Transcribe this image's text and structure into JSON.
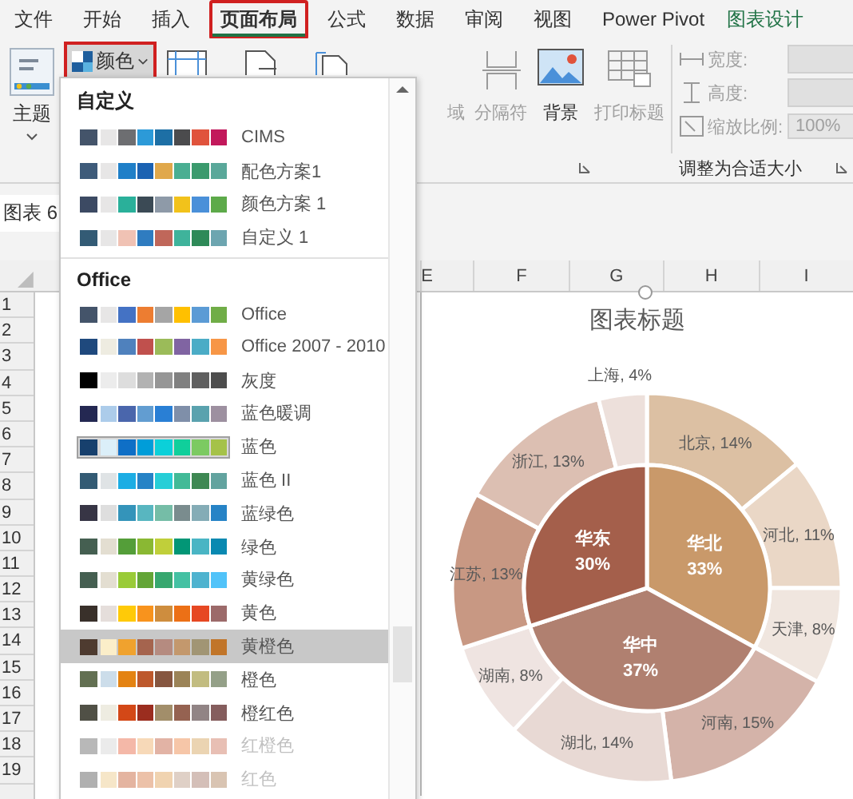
{
  "tabs": [
    {
      "label": "文件",
      "selected": false,
      "highlighted": false,
      "contextual": false
    },
    {
      "label": "开始",
      "selected": false,
      "highlighted": false,
      "contextual": false
    },
    {
      "label": "插入",
      "selected": false,
      "highlighted": false,
      "contextual": false
    },
    {
      "label": "页面布局",
      "selected": true,
      "highlighted": true,
      "contextual": false
    },
    {
      "label": "公式",
      "selected": false,
      "highlighted": false,
      "contextual": false
    },
    {
      "label": "数据",
      "selected": false,
      "highlighted": false,
      "contextual": false
    },
    {
      "label": "审阅",
      "selected": false,
      "highlighted": false,
      "contextual": false
    },
    {
      "label": "视图",
      "selected": false,
      "highlighted": false,
      "contextual": false
    },
    {
      "label": "Power Pivot",
      "selected": false,
      "highlighted": false,
      "contextual": false
    },
    {
      "label": "图表设计",
      "selected": false,
      "highlighted": false,
      "contextual": true
    }
  ],
  "ribbon": {
    "theme_button": {
      "label": "主题"
    },
    "colors_button": {
      "label": "颜色",
      "highlighted": true
    },
    "page_buttons": [
      {
        "label": "域",
        "disabled": true,
        "kind": "area"
      },
      {
        "label": "分隔符",
        "disabled": true,
        "kind": "breaks"
      },
      {
        "label": "背景",
        "disabled": false,
        "kind": "background"
      },
      {
        "label": "打印标题",
        "disabled": true,
        "kind": "titles"
      }
    ],
    "scale_group": {
      "width_label": "宽度:",
      "height_label": "高度:",
      "scale_label": "缩放比例:",
      "scale_value": "100%",
      "group_label": "调整为合适大小"
    }
  },
  "name_box": "图表 6",
  "columns": [
    "E",
    "F",
    "G",
    "H",
    "I"
  ],
  "rows": [
    "1",
    "2",
    "3",
    "4",
    "5",
    "6",
    "7",
    "8",
    "9",
    "10",
    "11",
    "12",
    "13",
    "14",
    "15",
    "16",
    "17",
    "18",
    "19"
  ],
  "menu": {
    "sections": [
      {
        "title": "自定义",
        "items": [
          {
            "label": "CIMS",
            "selected": false,
            "current": false,
            "disabled": false,
            "swatches": [
              {
                "color": "#44546a"
              },
              {
                "color": "#e7e6e6"
              },
              {
                "color": "#6d6e71"
              },
              {
                "color": "#2c9ad8"
              },
              {
                "color": "#1d6fa5"
              },
              {
                "color": "#4b4b4d"
              },
              {
                "color": "#e0533c"
              },
              {
                "color": "#c2185b"
              }
            ]
          },
          {
            "label": "配色方案1",
            "selected": false,
            "current": false,
            "disabled": false,
            "swatches": [
              {
                "color": "#3e5b7a"
              },
              {
                "color": "#e7e6e6"
              },
              {
                "color": "#1f7fc8"
              },
              {
                "color": "#1b62b2"
              },
              {
                "color": "#e0a84b"
              },
              {
                "color": "#4aae92"
              },
              {
                "color": "#3b9a6d"
              },
              {
                "color": "#5aa89a"
              }
            ]
          },
          {
            "label": "颜色方案 1",
            "selected": false,
            "current": false,
            "disabled": false,
            "swatches": [
              {
                "color": "#3c4a63"
              },
              {
                "color": "#e7e6e6"
              },
              {
                "color": "#2ab09a"
              },
              {
                "color": "#3b4a55"
              },
              {
                "color": "#8e9aa8"
              },
              {
                "color": "#f2c21b"
              },
              {
                "color": "#4a90d9"
              },
              {
                "color": "#5daa4a"
              }
            ]
          },
          {
            "label": "自定义 1",
            "selected": false,
            "current": false,
            "disabled": false,
            "swatches": [
              {
                "color": "#335b75"
              },
              {
                "color": "#e7e6e6"
              },
              {
                "color": "#f0c2b4"
              },
              {
                "color": "#2f7cc0"
              },
              {
                "color": "#c0675a"
              },
              {
                "color": "#3fb39b"
              },
              {
                "color": "#2e8a58"
              },
              {
                "color": "#6da5b0"
              }
            ]
          }
        ]
      },
      {
        "title": "Office",
        "items": [
          {
            "label": "Office",
            "selected": false,
            "current": false,
            "disabled": false,
            "swatches": [
              {
                "color": "#44546a"
              },
              {
                "color": "#e7e6e6"
              },
              {
                "color": "#4472c4"
              },
              {
                "color": "#ed7d31"
              },
              {
                "color": "#a5a5a5"
              },
              {
                "color": "#ffc000"
              },
              {
                "color": "#5b9bd5"
              },
              {
                "color": "#70ad47"
              }
            ]
          },
          {
            "label": "Office 2007 - 2010",
            "selected": false,
            "current": false,
            "disabled": false,
            "swatches": [
              {
                "color": "#1f497d"
              },
              {
                "color": "#eeece1"
              },
              {
                "color": "#4f81bd"
              },
              {
                "color": "#c0504d"
              },
              {
                "color": "#9bbb59"
              },
              {
                "color": "#8064a2"
              },
              {
                "color": "#4bacc6"
              },
              {
                "color": "#f79646"
              }
            ]
          },
          {
            "label": "灰度",
            "selected": false,
            "current": false,
            "disabled": false,
            "swatches": [
              {
                "color": "#000000"
              },
              {
                "color": "#ececec"
              },
              {
                "color": "#dddddd"
              },
              {
                "color": "#b2b2b2"
              },
              {
                "color": "#969696"
              },
              {
                "color": "#808080"
              },
              {
                "color": "#5f5f5f"
              },
              {
                "color": "#4d4d4d"
              }
            ]
          },
          {
            "label": "蓝色暖调",
            "selected": false,
            "current": false,
            "disabled": false,
            "swatches": [
              {
                "color": "#242852"
              },
              {
                "color": "#acccea"
              },
              {
                "color": "#4a66ac"
              },
              {
                "color": "#629dd1"
              },
              {
                "color": "#297fd5"
              },
              {
                "color": "#7f8fa9"
              },
              {
                "color": "#5aa2ae"
              },
              {
                "color": "#9d90a0"
              }
            ]
          },
          {
            "label": "蓝色",
            "selected": false,
            "current": true,
            "disabled": false,
            "swatches": [
              {
                "color": "#17406d"
              },
              {
                "color": "#dbeff9"
              },
              {
                "color": "#0f6fc6"
              },
              {
                "color": "#009dd9"
              },
              {
                "color": "#0bd0d9"
              },
              {
                "color": "#10cf9b"
              },
              {
                "color": "#7cca62"
              },
              {
                "color": "#a5c249"
              }
            ]
          },
          {
            "label": "蓝色 II",
            "selected": false,
            "current": false,
            "disabled": false,
            "swatches": [
              {
                "color": "#335b74"
              },
              {
                "color": "#dfe3e5"
              },
              {
                "color": "#1cade4"
              },
              {
                "color": "#2683c6"
              },
              {
                "color": "#27ced7"
              },
              {
                "color": "#42ba97"
              },
              {
                "color": "#3e8853"
              },
              {
                "color": "#62a39f"
              }
            ]
          },
          {
            "label": "蓝绿色",
            "selected": false,
            "current": false,
            "disabled": false,
            "swatches": [
              {
                "color": "#373545"
              },
              {
                "color": "#dedede"
              },
              {
                "color": "#3494ba"
              },
              {
                "color": "#58b6c0"
              },
              {
                "color": "#75bda7"
              },
              {
                "color": "#7a8c8e"
              },
              {
                "color": "#84acb6"
              },
              {
                "color": "#2683c6"
              }
            ]
          },
          {
            "label": "绿色",
            "selected": false,
            "current": false,
            "disabled": false,
            "swatches": [
              {
                "color": "#455f51"
              },
              {
                "color": "#e3ded1"
              },
              {
                "color": "#549e39"
              },
              {
                "color": "#8ab833"
              },
              {
                "color": "#c0cf3a"
              },
              {
                "color": "#029676"
              },
              {
                "color": "#4ab5c4"
              },
              {
                "color": "#0989b1"
              }
            ]
          },
          {
            "label": "黄绿色",
            "selected": false,
            "current": false,
            "disabled": false,
            "swatches": [
              {
                "color": "#455f51"
              },
              {
                "color": "#e3ded1"
              },
              {
                "color": "#99cb38"
              },
              {
                "color": "#63a537"
              },
              {
                "color": "#37a76f"
              },
              {
                "color": "#44c1a3"
              },
              {
                "color": "#4eb3cf"
              },
              {
                "color": "#51c3f9"
              }
            ]
          },
          {
            "label": "黄色",
            "selected": false,
            "current": false,
            "disabled": false,
            "swatches": [
              {
                "color": "#39302a"
              },
              {
                "color": "#e5dedb"
              },
              {
                "color": "#ffca08"
              },
              {
                "color": "#f8931d"
              },
              {
                "color": "#ce8d3e"
              },
              {
                "color": "#ec7016"
              },
              {
                "color": "#e64823"
              },
              {
                "color": "#9c6a6a"
              }
            ]
          },
          {
            "label": "黄橙色",
            "selected": true,
            "current": false,
            "disabled": false,
            "swatches": [
              {
                "color": "#4e3b30"
              },
              {
                "color": "#fbeec9"
              },
              {
                "color": "#f0a22e"
              },
              {
                "color": "#a5644e"
              },
              {
                "color": "#b58b80"
              },
              {
                "color": "#c3986d"
              },
              {
                "color": "#a19574"
              },
              {
                "color": "#c17529"
              }
            ]
          },
          {
            "label": "橙色",
            "selected": false,
            "current": false,
            "disabled": false,
            "swatches": [
              {
                "color": "#637052"
              },
              {
                "color": "#ccddea"
              },
              {
                "color": "#e48312"
              },
              {
                "color": "#bd582c"
              },
              {
                "color": "#865640"
              },
              {
                "color": "#9b8357"
              },
              {
                "color": "#c2bc80"
              },
              {
                "color": "#94a088"
              }
            ]
          },
          {
            "label": "橙红色",
            "selected": false,
            "current": false,
            "disabled": false,
            "swatches": [
              {
                "color": "#505046"
              },
              {
                "color": "#eeece1"
              },
              {
                "color": "#d34817"
              },
              {
                "color": "#9b2d1f"
              },
              {
                "color": "#a28e6a"
              },
              {
                "color": "#956251"
              },
              {
                "color": "#918485"
              },
              {
                "color": "#855d5d"
              }
            ]
          },
          {
            "label": "红橙色",
            "selected": false,
            "current": false,
            "disabled": true,
            "swatches": [
              {
                "color": "#b8b8b8"
              },
              {
                "color": "#ebebeb"
              },
              {
                "color": "#f4b8a8"
              },
              {
                "color": "#f7d9b8"
              },
              {
                "color": "#e2b3a5"
              },
              {
                "color": "#f6c6a8"
              },
              {
                "color": "#ebd4b2"
              },
              {
                "color": "#e8bfb4"
              }
            ]
          },
          {
            "label": "红色",
            "selected": false,
            "current": false,
            "disabled": true,
            "swatches": [
              {
                "color": "#b0b0b0"
              },
              {
                "color": "#f6e6c8"
              },
              {
                "color": "#e4b4a0"
              },
              {
                "color": "#ecc1a8"
              },
              {
                "color": "#f0d3b0"
              },
              {
                "color": "#dfd0c6"
              },
              {
                "color": "#d4bfb8"
              },
              {
                "color": "#d9c4b2"
              }
            ]
          }
        ]
      }
    ]
  },
  "chart": {
    "outer": {
      "chart_data": {
        "type": "donut",
        "title": "图表标题",
        "values": [
          14,
          11,
          8,
          15,
          14,
          8,
          13,
          13,
          4
        ],
        "data_labels": true,
        "value_labels": [
          "北京, 14%",
          "河北, 11%",
          "天津, 8%",
          "河南, 15%",
          "湖北, 14%",
          "湖南, 8%",
          "江苏, 13%",
          "浙江, 13%",
          "上海, 4%"
        ]
      }
    },
    "inner": {
      "chart_data": {
        "type": "pie",
        "categories": [
          "华北",
          "华中",
          "华东"
        ],
        "values": [
          33,
          37,
          30
        ],
        "data_labels": true,
        "value_labels": [
          "33%",
          "37%",
          "30%"
        ]
      }
    }
  }
}
